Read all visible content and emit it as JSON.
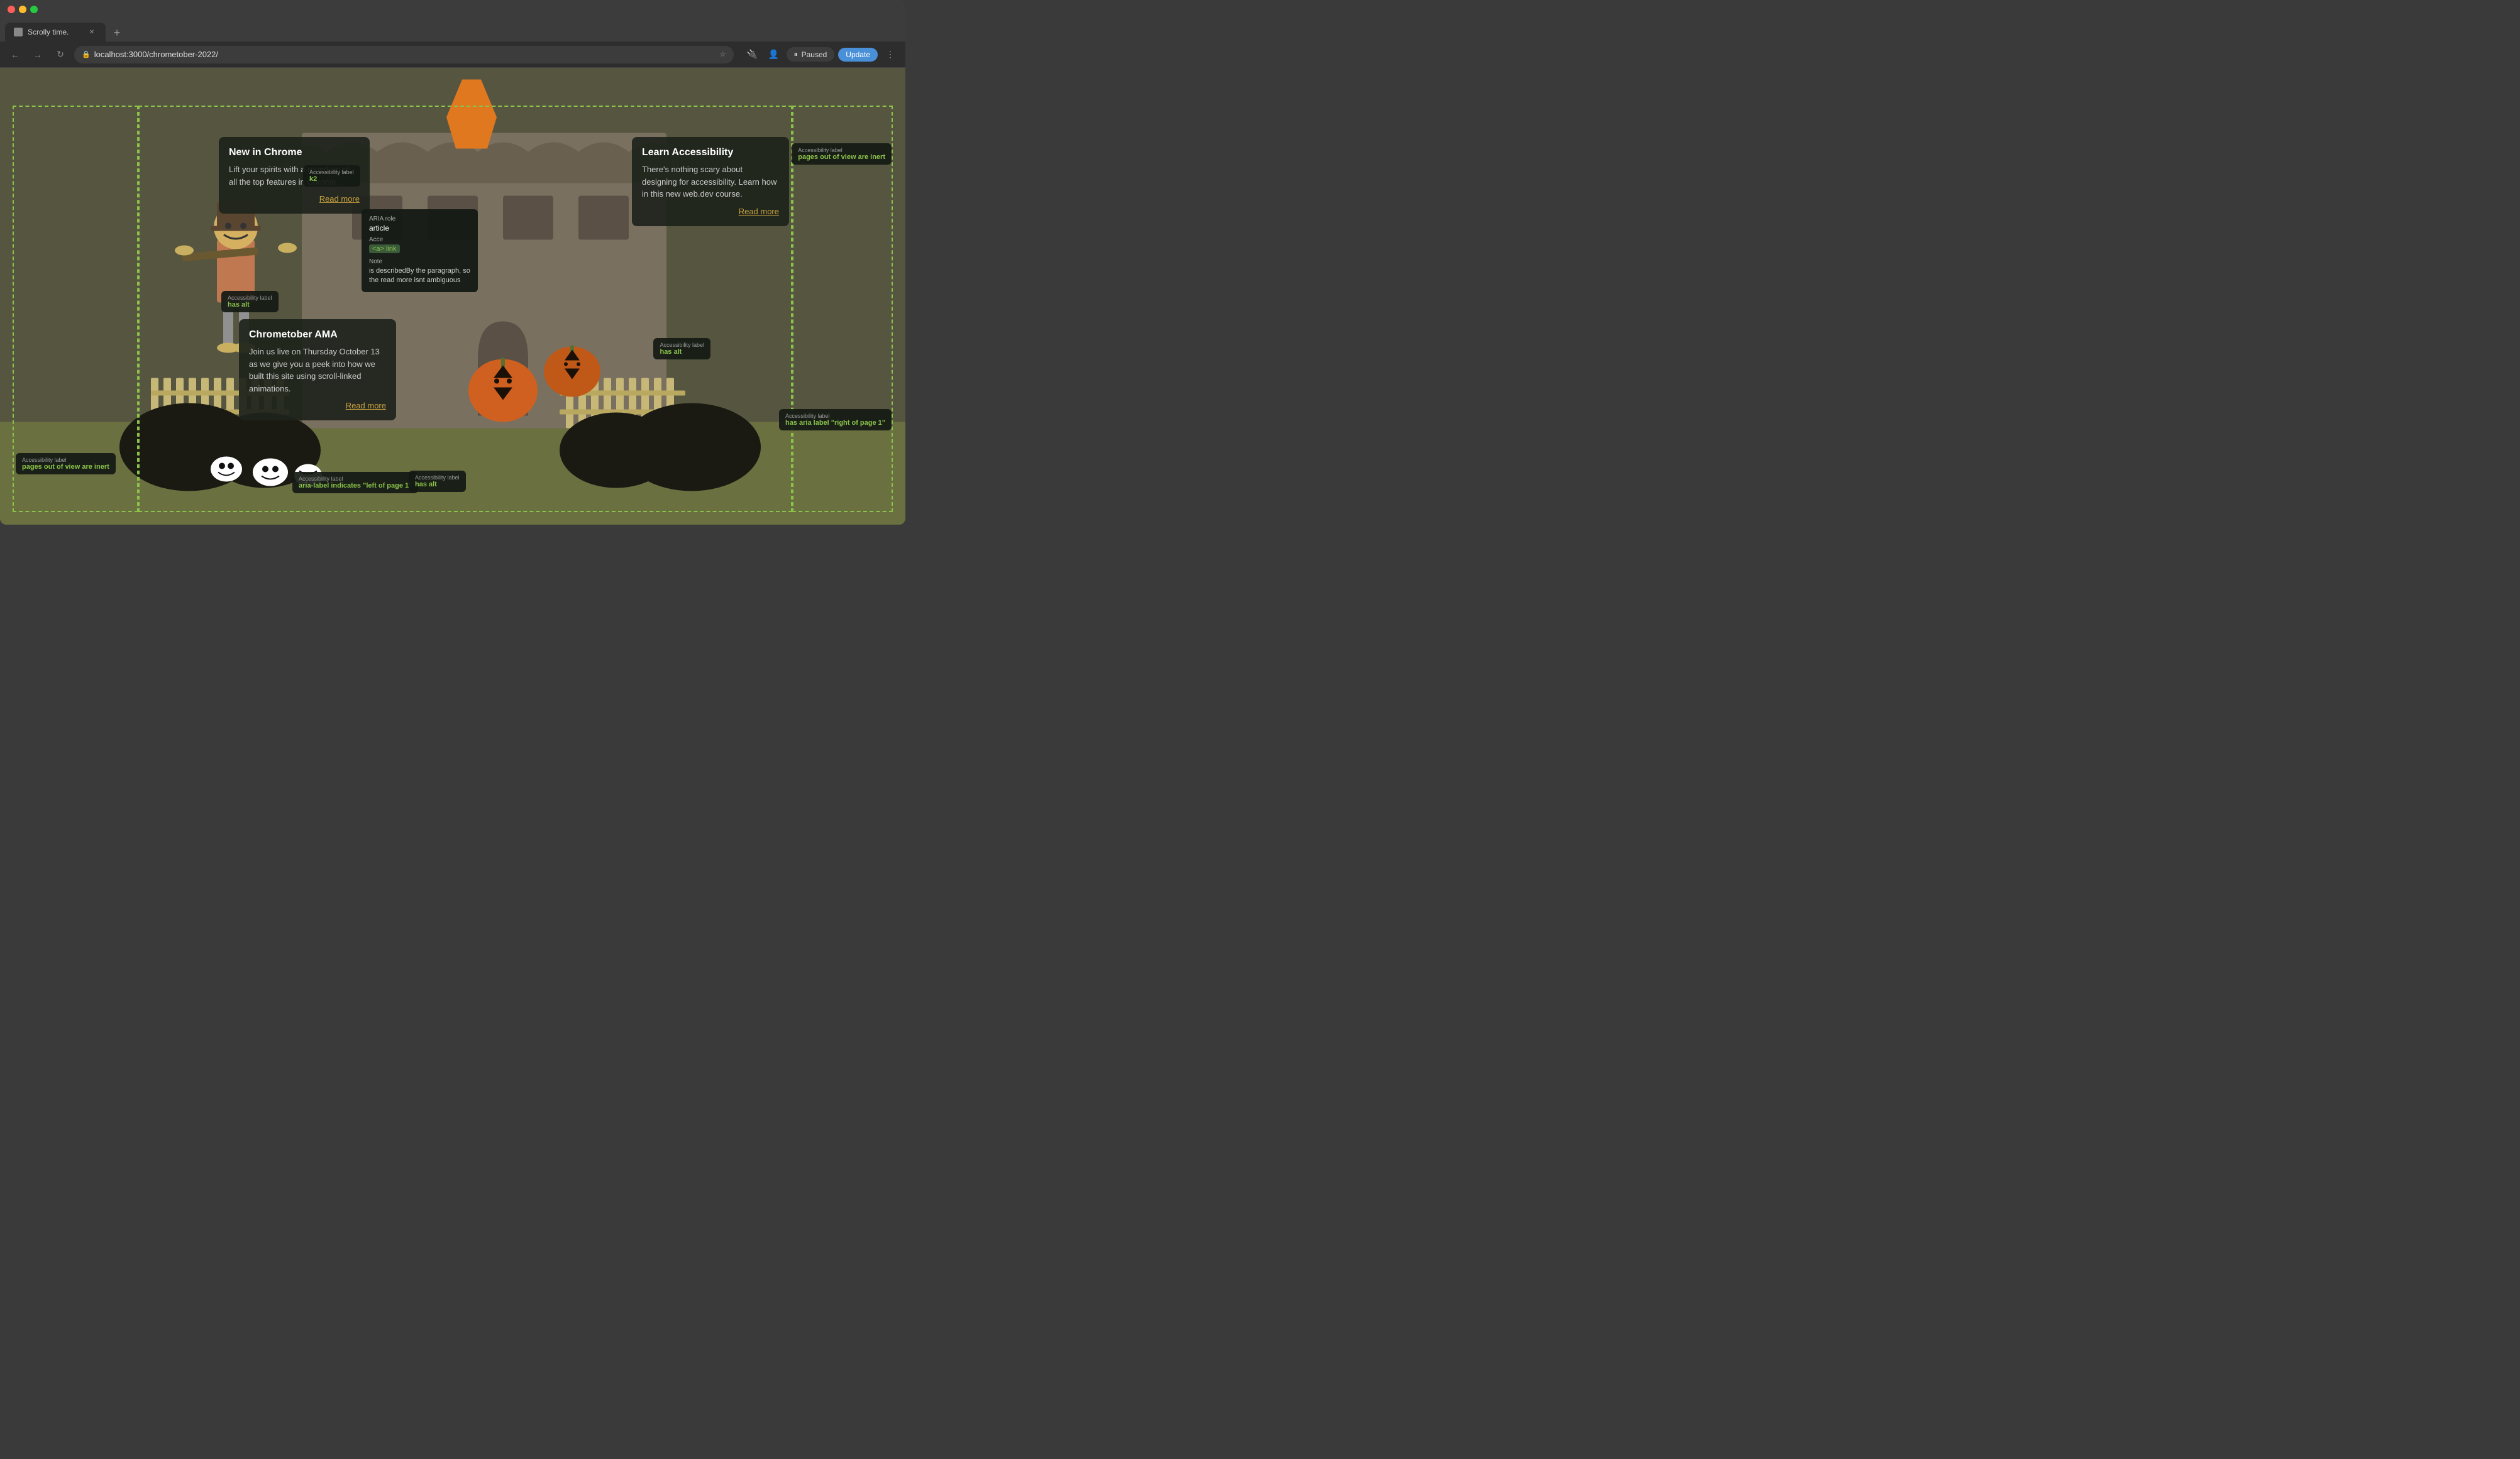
{
  "browser": {
    "tab_title": "Scrolly time.",
    "url": "localhost:3000/chrometober-2022/",
    "nav": {
      "back": "←",
      "forward": "→",
      "refresh": "↻"
    },
    "actions": {
      "paused_label": "Paused",
      "update_label": "Update"
    }
  },
  "scene": {
    "article_new_in_chrome": {
      "title": "New in Chrome",
      "body": "Lift your spirits with a round-up of all the top features in Chrome.",
      "read_more": "Read more"
    },
    "article_learn_accessibility": {
      "title": "Learn Accessibility",
      "body": "There's nothing scary about designing for accessibility. Learn how in this new web.dev course.",
      "read_more": "Read more"
    },
    "article_chrometober_ama": {
      "title": "Chrometober AMA",
      "body": "Join us live on Thursday October 13 as we give you a peek into how we built this site using scroll-linked animations.",
      "read_more": "Read more"
    }
  },
  "tooltips": {
    "acc_label_alt": {
      "label": "Accessibility label",
      "value": "has alt"
    },
    "acc_label_alt2": {
      "label": "Accessibility label",
      "value": "has alt"
    },
    "acc_label_pages_left": {
      "label": "Accessibility label",
      "value": "pages out of view are inert"
    },
    "acc_label_pages_right": {
      "label": "Accessibility label",
      "value": "pages out of view are inert"
    },
    "acc_label_aria_right": {
      "label": "Accessibility label",
      "value": "has aria label \"right of page 1\""
    },
    "acc_label_aria_left": {
      "label": "Accessibility label",
      "value": "aria-label indicates \"left of page 1\""
    },
    "aria_tooltip": {
      "aria_role_label": "ARIA role",
      "aria_role_value": "article",
      "acce_label": "Acce",
      "acce_tag": "<a> link",
      "note_label": "Note",
      "note_text": "is describedBy the paragraph, so the read more isnt ambiguous"
    },
    "acc_label_k2": {
      "label": "Accessibility label",
      "value": "k2"
    }
  }
}
